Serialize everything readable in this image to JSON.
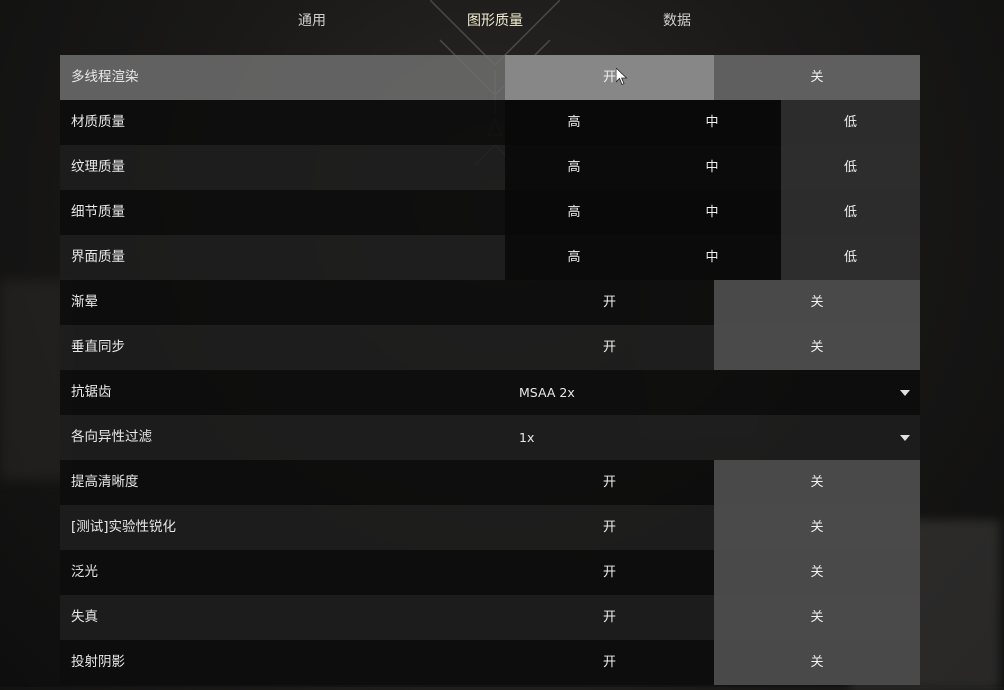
{
  "tabs": [
    {
      "label": "通用",
      "active": false
    },
    {
      "label": "图形质量",
      "active": true
    },
    {
      "label": "数据",
      "active": false
    }
  ],
  "settings": {
    "multithread": {
      "label": "多线程渲染",
      "on": "开",
      "off": "关",
      "value": "on"
    },
    "material": {
      "label": "材质质量",
      "high": "高",
      "mid": "中",
      "low": "低",
      "value": "low"
    },
    "texture": {
      "label": "纹理质量",
      "high": "高",
      "mid": "中",
      "low": "低",
      "value": "low"
    },
    "detail": {
      "label": "细节质量",
      "high": "高",
      "mid": "中",
      "low": "低",
      "value": "low"
    },
    "ui": {
      "label": "界面质量",
      "high": "高",
      "mid": "中",
      "low": "低",
      "value": "low"
    },
    "vignette": {
      "label": "渐晕",
      "on": "开",
      "off": "关",
      "value": "off"
    },
    "vsync": {
      "label": "垂直同步",
      "on": "开",
      "off": "关",
      "value": "off"
    },
    "antialias": {
      "label": "抗锯齿",
      "value": "MSAA 2x"
    },
    "anisotropic": {
      "label": "各向异性过滤",
      "value": "1x"
    },
    "sharpness": {
      "label": "提高清晰度",
      "on": "开",
      "off": "关",
      "value": "off"
    },
    "sharpening": {
      "label": "[测试]实验性锐化",
      "on": "开",
      "off": "关",
      "value": "off"
    },
    "bloom": {
      "label": "泛光",
      "on": "开",
      "off": "关",
      "value": "off"
    },
    "distortion": {
      "label": "失真",
      "on": "开",
      "off": "关",
      "value": "off"
    },
    "shadows": {
      "label": "投射阴影",
      "on": "开",
      "off": "关",
      "value": "off"
    }
  },
  "icons": {
    "dropdown": "chevron-down-icon",
    "cursor": "mouse-pointer-icon",
    "emblem": "emblem-icon"
  },
  "colors": {
    "active_tab": "#f2ecd0",
    "text": "#e8e8e8"
  }
}
